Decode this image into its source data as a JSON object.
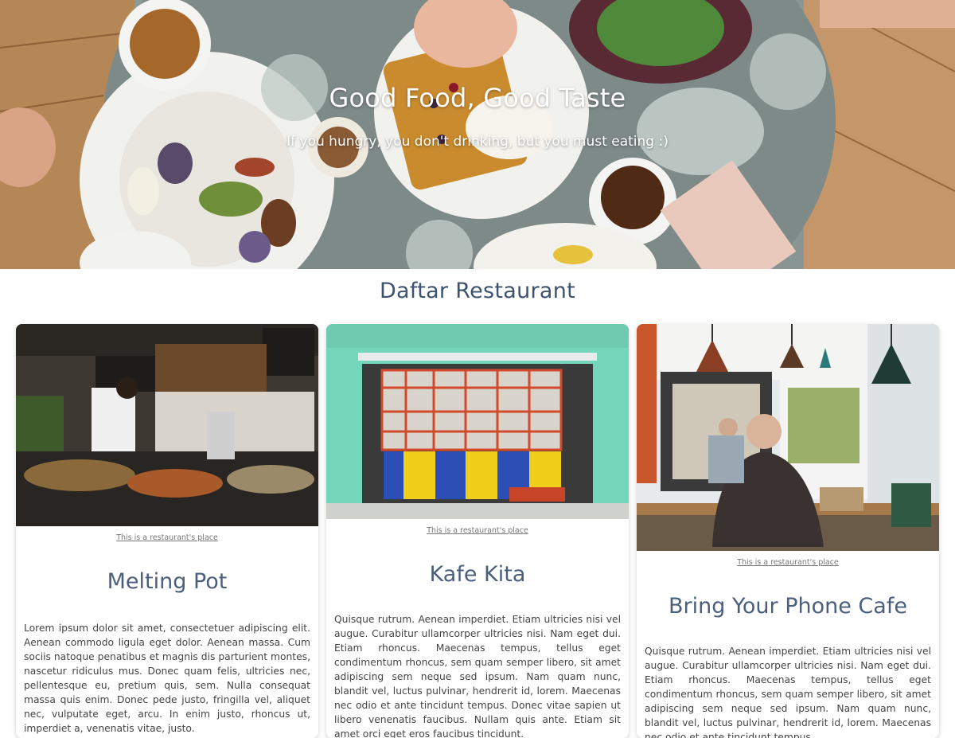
{
  "hero": {
    "title": "Good Food, Good Taste",
    "subtitle": "If you hungry, you don't drinking, but you must eating :)"
  },
  "section": {
    "title": "Daftar Restaurant"
  },
  "restaurants": [
    {
      "caption": "This is a restaurant's place",
      "name": "Melting Pot",
      "description": "Lorem ipsum dolor sit amet, consectetuer adipiscing elit. Aenean commodo ligula eget dolor. Aenean massa. Cum sociis natoque penatibus et magnis dis parturient montes, nascetur ridiculus mus. Donec quam felis, ultricies nec, pellentesque eu, pretium quis, sem. Nulla consequat massa quis enim. Donec pede justo, fringilla vel, aliquet nec, vulputate eget, arcu. In enim justo, rhoncus ut, imperdiet a, venenatis vitae, justo."
    },
    {
      "caption": "This is a restaurant's place",
      "name": "Kafe Kita",
      "description": "Quisque rutrum. Aenean imperdiet. Etiam ultricies nisi vel augue. Curabitur ullamcorper ultricies nisi. Nam eget dui. Etiam rhoncus. Maecenas tempus, tellus eget condimentum rhoncus, sem quam semper libero, sit amet adipiscing sem neque sed ipsum. Nam quam nunc, blandit vel, luctus pulvinar, hendrerit id, lorem. Maecenas nec odio et ante tincidunt tempus. Donec vitae sapien ut libero venenatis faucibus. Nullam quis ante. Etiam sit amet orci eget eros faucibus tincidunt."
    },
    {
      "caption": "This is a restaurant's place",
      "name": "Bring Your Phone Cafe",
      "description": "Quisque rutrum. Aenean imperdiet. Etiam ultricies nisi vel augue. Curabitur ullamcorper ultricies nisi. Nam eget dui. Etiam rhoncus. Maecenas tempus, tellus eget condimentum rhoncus, sem quam semper libero, sit amet adipiscing sem neque sed ipsum. Nam quam nunc, blandit vel, luctus pulvinar, hendrerit id, lorem. Maecenas nec odio et ante tincidunt tempus."
    }
  ],
  "colors": {
    "heading": "#3d5270",
    "card_title": "#4a5f7e",
    "hero_text": "#ffffff"
  }
}
